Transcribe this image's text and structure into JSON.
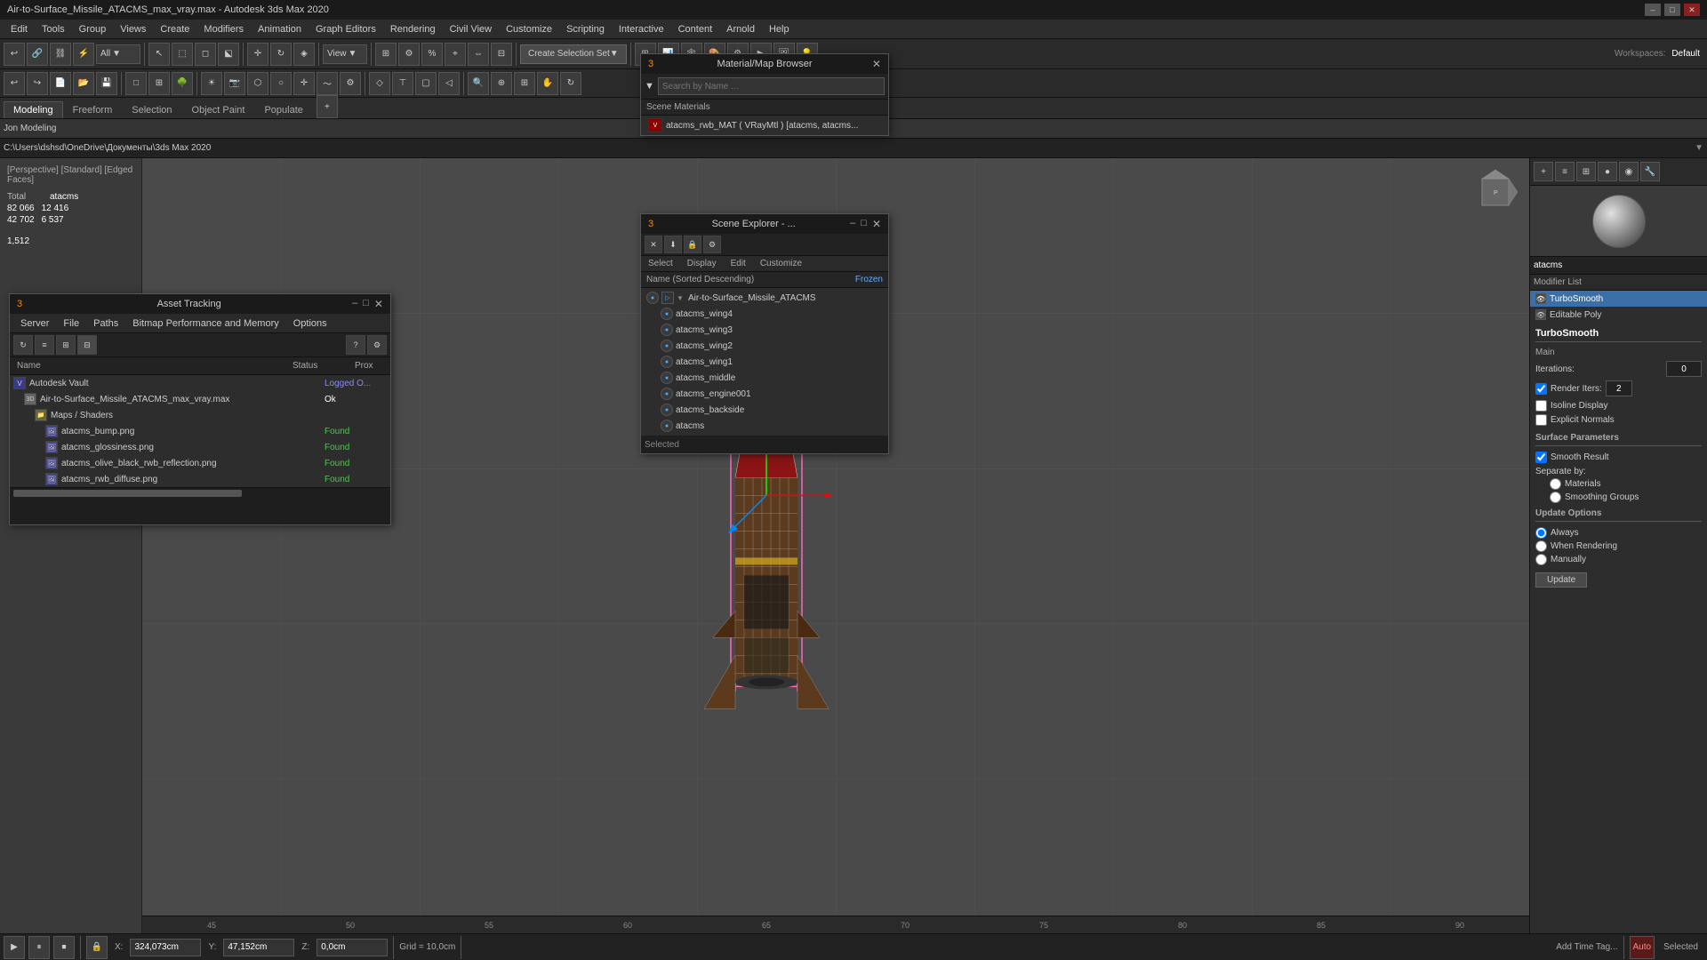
{
  "titlebar": {
    "title": "Air-to-Surface_Missile_ATACMS_max_vray.max - Autodesk 3ds Max 2020",
    "minimize": "–",
    "maximize": "□",
    "close": "✕"
  },
  "menubar": {
    "items": [
      "Edit",
      "Tools",
      "Group",
      "Views",
      "Create",
      "Modifiers",
      "Animation",
      "Graph Editors",
      "Rendering",
      "Civil View",
      "Customize",
      "Scripting",
      "Interactive",
      "Content",
      "Arnold",
      "Help"
    ]
  },
  "toolbar": {
    "view_dropdown": "View",
    "create_selection": "Create Selection Set",
    "workspaces": "Workspaces:",
    "default": "Default"
  },
  "tabs": {
    "items": [
      "Modeling",
      "Freeform",
      "Selection",
      "Object Paint",
      "Populate"
    ],
    "active": "Modeling"
  },
  "subtabs": {
    "label": "Jon Modeling"
  },
  "viewport": {
    "label": "[Perspective] [Standard] [Edged Faces]",
    "stats": {
      "total_label": "Total",
      "total_name": "atacms",
      "v1": "82 066",
      "v2": "12 416",
      "v3": "42 702",
      "v4": "6 537",
      "v5": "1,512"
    },
    "ruler_marks": [
      "45",
      "50",
      "55",
      "60",
      "65",
      "70",
      "75",
      "80",
      "85",
      "90"
    ]
  },
  "path_bar": {
    "path": "C:\\Users\\dshsd\\OneDrive\\Документы\\3ds Max 2020"
  },
  "right_panel": {
    "obj_name": "atacms",
    "modifier_list_label": "Modifier List",
    "modifiers": [
      {
        "name": "TurboSmooth",
        "selected": true
      },
      {
        "name": "Editable Poly",
        "selected": false
      }
    ],
    "turbo_smooth": {
      "title": "TurboSmooth",
      "main_label": "Main",
      "iterations_label": "Iterations:",
      "iterations_val": "0",
      "render_iters_label": "Render Iters:",
      "render_iters_val": "2",
      "isoline_label": "Isoline Display",
      "explicit_label": "Explicit Normals",
      "surface_params_title": "Surface Parameters",
      "smooth_result_label": "Smooth Result",
      "separate_label": "Separate by:",
      "materials_label": "Materials",
      "smoothing_label": "Smoothing Groups",
      "update_options_label": "Update Options",
      "always_label": "Always",
      "when_rendering_label": "When Rendering",
      "manually_label": "Manually",
      "update_btn": "Update"
    }
  },
  "mat_browser": {
    "title": "Material/Map Browser",
    "search_placeholder": "Search by Name ...",
    "section": "Scene Materials",
    "item": "atacms_rwb_MAT  ( VRayMtl )  [atacms, atacms..."
  },
  "scene_explorer": {
    "title": "Scene Explorer - ...",
    "tabs": [
      "Select",
      "Display",
      "Edit",
      "Customize"
    ],
    "header_name": "Name (Sorted Descending)",
    "header_frozen": "Frozen",
    "root": "Air-to-Surface_Missile_ATACMS",
    "items": [
      "atacms_wing4",
      "atacms_wing3",
      "atacms_wing2",
      "atacms_wing1",
      "atacms_middle",
      "atacms_engine001",
      "atacms_backside",
      "atacms"
    ]
  },
  "asset_tracking": {
    "title": "Asset Tracking",
    "menu_items": [
      "Server",
      "File",
      "Paths",
      "Bitmap Performance and Memory",
      "Options"
    ],
    "col_name": "Name",
    "col_status": "Status",
    "col_proxy": "Prox",
    "rows": [
      {
        "indent": 0,
        "name": "Autodesk Vault",
        "status": "Logged O...",
        "proxy": ""
      },
      {
        "indent": 1,
        "name": "Air-to-Surface_Missile_ATACMS_max_vray.max",
        "status": "Ok",
        "proxy": ""
      },
      {
        "indent": 2,
        "name": "Maps / Shaders",
        "status": "",
        "proxy": ""
      },
      {
        "indent": 3,
        "name": "atacms_bump.png",
        "status": "Found",
        "proxy": ""
      },
      {
        "indent": 3,
        "name": "atacms_glossiness.png",
        "status": "Found",
        "proxy": ""
      },
      {
        "indent": 3,
        "name": "atacms_olive_black_rwb_reflection.png",
        "status": "Found",
        "proxy": ""
      },
      {
        "indent": 3,
        "name": "atacms_rwb_diffuse.png",
        "status": "Found",
        "proxy": ""
      }
    ]
  },
  "bottom_toolbar": {
    "x_label": "X:",
    "x_val": "324,073cm",
    "y_label": "Y:",
    "y_val": "47,152cm",
    "z_label": "Z:",
    "z_val": "0,0cm",
    "grid_label": "Grid = 10,0cm",
    "time_label": "Add Time Tag...",
    "auto_label": "Auto",
    "selected_label": "Selected"
  }
}
